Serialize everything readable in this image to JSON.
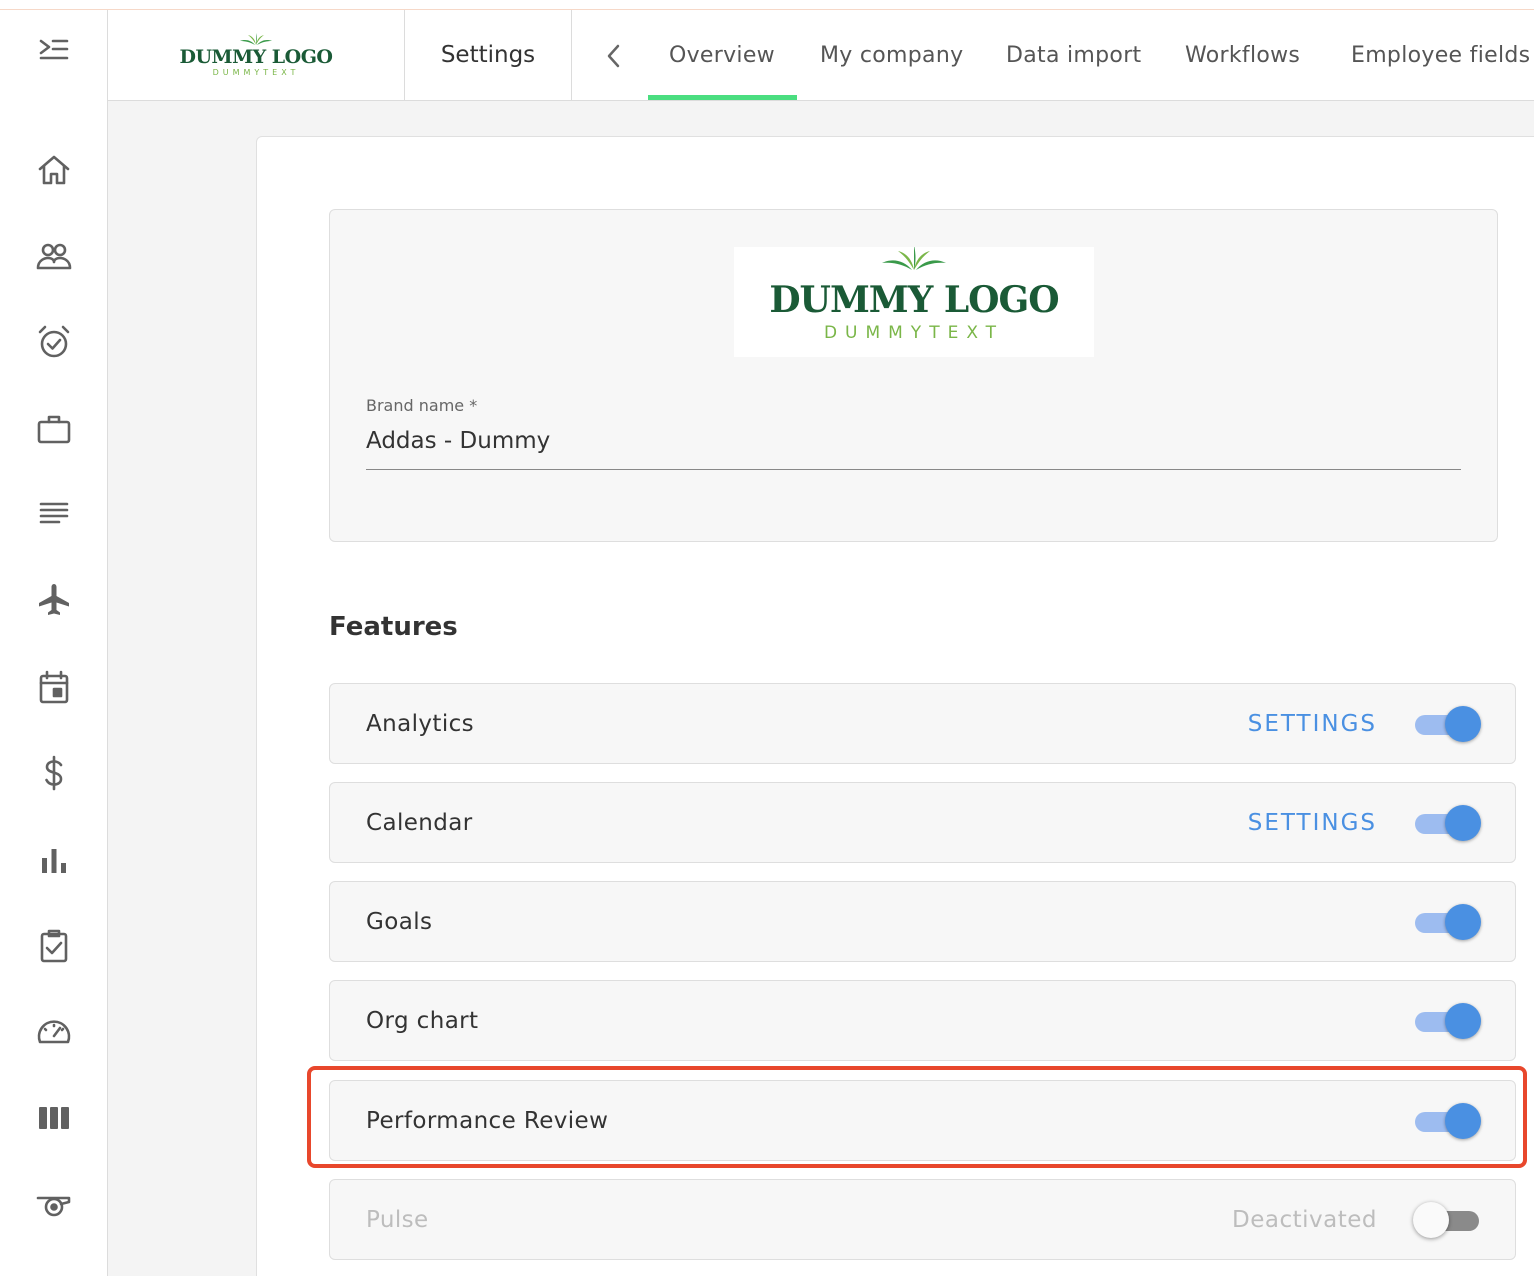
{
  "header": {
    "logo": {
      "title": "DUMMY LOGO",
      "subtitle": "DUMMYTEXT"
    },
    "section_title": "Settings",
    "tabs": [
      {
        "label": "Overview",
        "active": true
      },
      {
        "label": "My company",
        "active": false
      },
      {
        "label": "Data import",
        "active": false
      },
      {
        "label": "Workflows",
        "active": false
      },
      {
        "label": "Employee fields",
        "active": false
      }
    ]
  },
  "sidebar": {
    "items": [
      {
        "icon": "menu-collapse-icon"
      },
      {
        "icon": "home-icon"
      },
      {
        "icon": "people-icon"
      },
      {
        "icon": "alarm-check-icon"
      },
      {
        "icon": "briefcase-icon"
      },
      {
        "icon": "document-lines-icon"
      },
      {
        "icon": "airplane-icon"
      },
      {
        "icon": "calendar-event-icon"
      },
      {
        "icon": "dollar-icon"
      },
      {
        "icon": "bar-chart-icon"
      },
      {
        "icon": "clipboard-check-icon"
      },
      {
        "icon": "speedometer-icon"
      },
      {
        "icon": "columns-icon"
      },
      {
        "icon": "whistle-icon"
      }
    ]
  },
  "brand": {
    "logo": {
      "title": "DUMMY LOGO",
      "subtitle": "DUMMYTEXT"
    },
    "field_label": "Brand name *",
    "field_value": "Addas - Dummy"
  },
  "features": {
    "title": "Features",
    "items": [
      {
        "name": "Analytics",
        "action": "SETTINGS",
        "enabled": true
      },
      {
        "name": "Calendar",
        "action": "SETTINGS",
        "enabled": true
      },
      {
        "name": "Goals",
        "action": "",
        "enabled": true
      },
      {
        "name": "Org chart",
        "action": "",
        "enabled": true
      },
      {
        "name": "Performance Review",
        "action": "",
        "enabled": true,
        "highlighted": true
      },
      {
        "name": "Pulse",
        "action": "Deactivated",
        "enabled": false
      }
    ]
  },
  "colors": {
    "accent": "#4a90e2",
    "tab_indicator": "#4ade80",
    "highlight": "#e8472c",
    "logo_green_dark": "#1a5a36",
    "logo_green_light": "#7ab648"
  }
}
